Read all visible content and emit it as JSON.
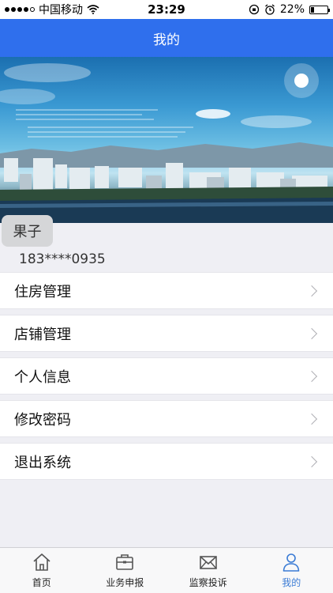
{
  "status_bar": {
    "carrier": "中国移动",
    "time": "23:29",
    "battery": "22%",
    "battery_level": 0.22
  },
  "nav": {
    "title": "我的"
  },
  "profile": {
    "name": "果子",
    "phone": "183****0935"
  },
  "menu": [
    {
      "label": "住房管理"
    },
    {
      "label": "店铺管理"
    },
    {
      "label": "个人信息"
    },
    {
      "label": "修改密码"
    },
    {
      "label": "退出系统"
    }
  ],
  "tabs": [
    {
      "label": "首页",
      "icon": "home-icon",
      "active": false
    },
    {
      "label": "业务申报",
      "icon": "briefcase-icon",
      "active": false
    },
    {
      "label": "监察投诉",
      "icon": "mail-icon",
      "active": false
    },
    {
      "label": "我的",
      "icon": "user-icon",
      "active": true
    }
  ],
  "colors": {
    "nav_blue": "#2f6fed",
    "active_tab": "#3a7bd5",
    "background": "#efeff4"
  }
}
